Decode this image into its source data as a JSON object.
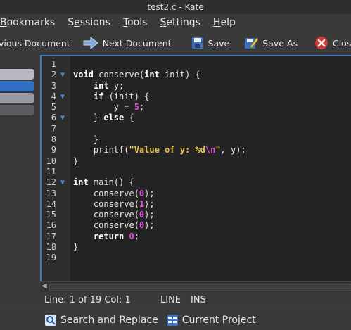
{
  "window": {
    "title": "test2.c - Kate"
  },
  "menu": [
    {
      "label": "Bookmarks",
      "mnemonic_index": 0
    },
    {
      "label": "Sessions",
      "mnemonic_index": 1
    },
    {
      "label": "Tools",
      "mnemonic_index": 0
    },
    {
      "label": "Settings",
      "mnemonic_index": 0
    },
    {
      "label": "Help",
      "mnemonic_index": 0
    }
  ],
  "toolbar": {
    "prev_label": "vious Document",
    "next_label": "Next Document",
    "save_label": "Save",
    "saveas_label": "Save As",
    "close_label": "Clos"
  },
  "editor": {
    "lines": [
      {
        "n": "1",
        "fold": false,
        "code": ""
      },
      {
        "n": "2",
        "fold": true,
        "code": "void conserve(int init) {"
      },
      {
        "n": "3",
        "fold": false,
        "code": "    int y;"
      },
      {
        "n": "4",
        "fold": true,
        "code": "    if (init) {"
      },
      {
        "n": "5",
        "fold": false,
        "code": "        y = 5;"
      },
      {
        "n": "6",
        "fold": true,
        "code": "    } else {"
      },
      {
        "n": "7",
        "fold": false,
        "code": ""
      },
      {
        "n": "8",
        "fold": false,
        "code": "    }"
      },
      {
        "n": "9",
        "fold": false,
        "code": "    printf(\"Value of y: %d\\n\", y);"
      },
      {
        "n": "10",
        "fold": false,
        "code": "}"
      },
      {
        "n": "11",
        "fold": false,
        "code": ""
      },
      {
        "n": "12",
        "fold": true,
        "code": "int main() {"
      },
      {
        "n": "13",
        "fold": false,
        "code": "    conserve(0);"
      },
      {
        "n": "14",
        "fold": false,
        "code": "    conserve(1);"
      },
      {
        "n": "15",
        "fold": false,
        "code": "    conserve(0);"
      },
      {
        "n": "16",
        "fold": false,
        "code": "    conserve(0);"
      },
      {
        "n": "17",
        "fold": false,
        "code": "    return 0;"
      },
      {
        "n": "18",
        "fold": false,
        "code": "}"
      },
      {
        "n": "19",
        "fold": false,
        "code": ""
      }
    ],
    "fold_marker": "▼"
  },
  "status": {
    "position": "Line: 1 of 19 Col: 1",
    "mode": "LINE",
    "insert": "INS"
  },
  "bottom": {
    "search_label": "Search and Replace",
    "project_label": "Current Project"
  },
  "colors": {
    "accent": "#4a78b5",
    "keyword": "#ffffff",
    "number": "#e24de2",
    "string": "#e8c54a",
    "close_icon": "#d23a3a"
  }
}
